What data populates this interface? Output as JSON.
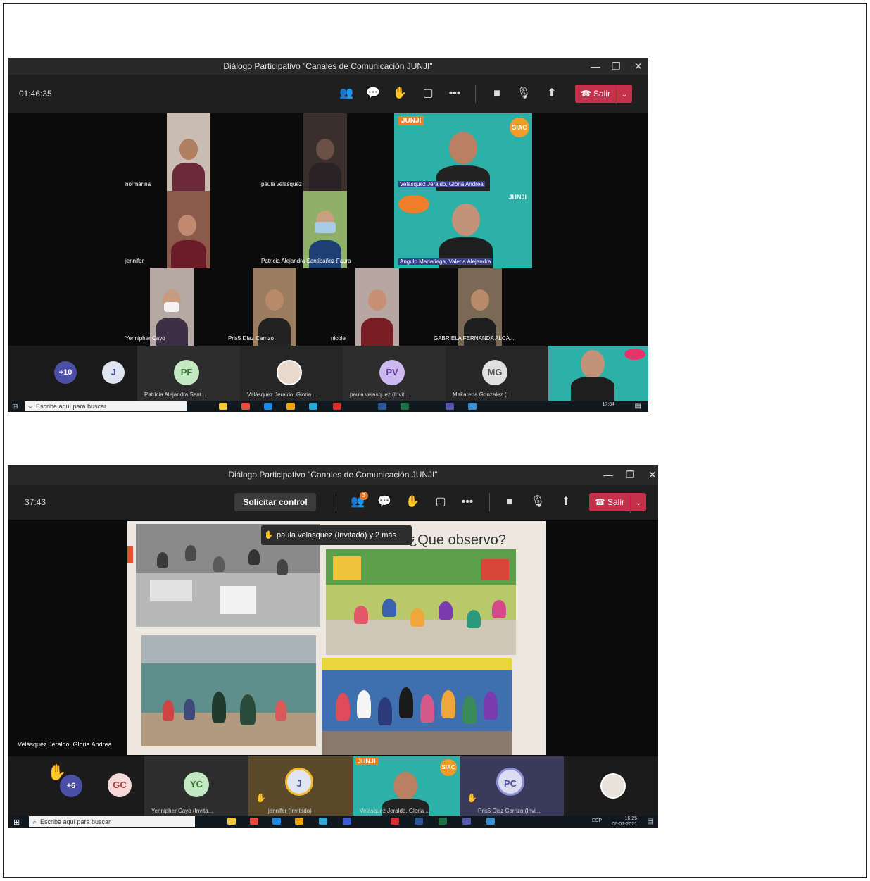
{
  "shot1": {
    "window_title": "Diálogo Participativo \"Canales de Comunicación JUNJI\"",
    "timer": "01:46:35",
    "leave_label": "Salir",
    "participants": [
      {
        "name": "normarina"
      },
      {
        "name": "paula velasquez"
      },
      {
        "name": "Velásquez Jeraldo, Gloria Andrea"
      },
      {
        "name": "jennifer"
      },
      {
        "name": "Patricia Alejandra Santibañez Faura"
      },
      {
        "name": "Angulo Madariaga, Valeria Alejandra"
      },
      {
        "name": "Yennipher Cayo"
      },
      {
        "name": "Pris5 Díaz Carrizo"
      },
      {
        "name": "nicole"
      },
      {
        "name": "GABRIELA FERNANDA ALCA..."
      }
    ],
    "junji_logo": "JUNJI",
    "siac_logo": "SIAC",
    "strip": {
      "more_count": "+10",
      "j_initial": "J",
      "tiles": [
        {
          "initials": "PF",
          "name": "Patricia Alejandra Sant..."
        },
        {
          "initials": "",
          "name": "Velásquez Jeraldo, Gloria ..."
        },
        {
          "initials": "PV",
          "name": "paula velasquez (Invit..."
        },
        {
          "initials": "MG",
          "name": "Makarena Gonzalez (I..."
        }
      ]
    },
    "taskbar": {
      "search_placeholder": "Escribe aquí para buscar",
      "time": "17:34"
    }
  },
  "shot2": {
    "window_title": "Diálogo Participativo \"Canales de Comunicación JUNJI\"",
    "timer": "37:43",
    "request_control": "Solicitar control",
    "leave_label": "Salir",
    "people_badge": "3",
    "raised_hands": "paula velasquez (Invitado) y 2 más",
    "slide_title": "¿Que observo?",
    "presenter": "Velásquez Jeraldo, Gloria Andrea",
    "strip": {
      "more_count": "+6",
      "gc_initials": "GC",
      "tiles": [
        {
          "initials": "YC",
          "name": "Yennipher Cayo (Invita..."
        },
        {
          "initials": "J",
          "name": "jennifer (Invitado)"
        },
        {
          "initials": "",
          "name": "Velásquez Jeraldo, Gloria ..."
        },
        {
          "initials": "PC",
          "name": "Pris5 Diaz Carrizo (Invi..."
        }
      ]
    },
    "taskbar": {
      "search_placeholder": "Escribe aquí para buscar",
      "time": "16:25",
      "date": "06-07-2021",
      "lang": "ESP"
    }
  }
}
